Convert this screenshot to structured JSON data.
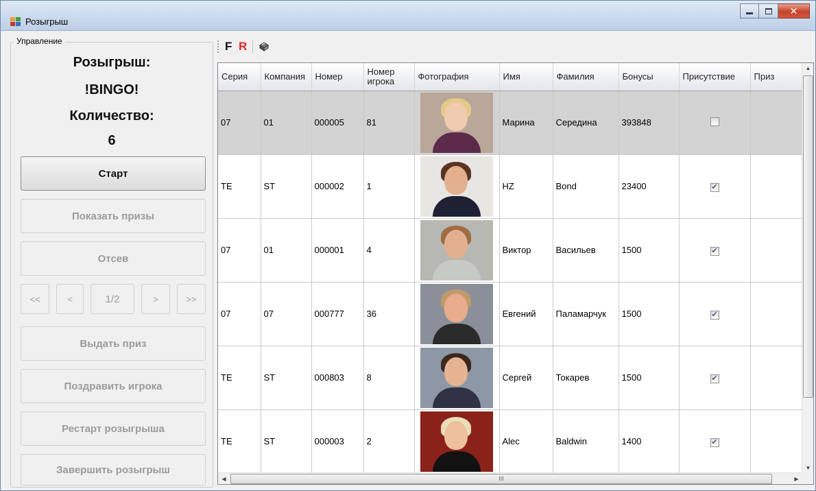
{
  "window": {
    "title": "Розыгрыш",
    "controls": {
      "minimize": "minimize-icon",
      "maximize": "maximize-icon",
      "close": "✕"
    }
  },
  "control_panel": {
    "group_title": "Управление",
    "draw_label": "Розыгрыш:",
    "draw_name": "!BINGO!",
    "count_label": "Количество:",
    "count_value": "6",
    "buttons": {
      "start": "Старт",
      "show_prizes": "Показать призы",
      "filter": "Отсев",
      "give_prize": "Выдать приз",
      "congratulate": "Поздравить игрока",
      "restart": "Рестарт розыгрыша",
      "finish": "Завершить розыгрыш"
    },
    "pager": {
      "first": "<<",
      "prev": "<",
      "page": "1/2",
      "next": ">",
      "last": ">>"
    }
  },
  "toolbar": {
    "f_label": "F",
    "r_label": "R",
    "print_icon": "printer-icon"
  },
  "grid": {
    "columns": [
      "Серия",
      "Компания",
      "Номер",
      "Номер игрока",
      "Фотография",
      "Имя",
      "Фамилия",
      "Бонусы",
      "Присутствие",
      "Приз"
    ],
    "rows": [
      {
        "series": "07",
        "company": "01",
        "number": "000005",
        "player_no": "81",
        "first_name": "Марина",
        "last_name": "Середина",
        "bonus": "393848",
        "present": false,
        "prize": "",
        "selected": true
      },
      {
        "series": "TE",
        "company": "ST",
        "number": "000002",
        "player_no": "1",
        "first_name": "HZ",
        "last_name": "Bond",
        "bonus": "23400",
        "present": true,
        "prize": "",
        "selected": false
      },
      {
        "series": "07",
        "company": "01",
        "number": "000001",
        "player_no": "4",
        "first_name": "Виктор",
        "last_name": "Васильев",
        "bonus": "1500",
        "present": true,
        "prize": "",
        "selected": false
      },
      {
        "series": "07",
        "company": "07",
        "number": "000777",
        "player_no": "36",
        "first_name": "Евгений",
        "last_name": "Паламарчук",
        "bonus": "1500",
        "present": true,
        "prize": "",
        "selected": false
      },
      {
        "series": "TE",
        "company": "ST",
        "number": "000803",
        "player_no": "8",
        "first_name": "Сергей",
        "last_name": "Токарев",
        "bonus": "1500",
        "present": true,
        "prize": "",
        "selected": false
      },
      {
        "series": "TE",
        "company": "ST",
        "number": "000003",
        "player_no": "2",
        "first_name": "Alec",
        "last_name": "Baldwin",
        "bonus": "1400",
        "present": true,
        "prize": "",
        "selected": false
      }
    ],
    "photos": [
      {
        "bg": "#b9a79a",
        "hair": "#e4c98a",
        "skin": "#f0cbb0",
        "body": "#5c2a4a"
      },
      {
        "bg": "#e8e6e2",
        "hair": "#5a3422",
        "skin": "#e2b08e",
        "body": "#1d2133"
      },
      {
        "bg": "#b8b8b2",
        "hair": "#9e6c43",
        "skin": "#e2b090",
        "body": "#c7c9c5"
      },
      {
        "bg": "#8a8f9a",
        "hair": "#c19a6b",
        "skin": "#e8ad8c",
        "body": "#2a2a2a"
      },
      {
        "bg": "#8d97a5",
        "hair": "#3b2a1d",
        "skin": "#e6b392",
        "body": "#2e3244"
      },
      {
        "bg": "#8a2219",
        "hair": "#eadfb8",
        "skin": "#efc09c",
        "body": "#121212"
      }
    ],
    "hscroll_mark": "III"
  }
}
